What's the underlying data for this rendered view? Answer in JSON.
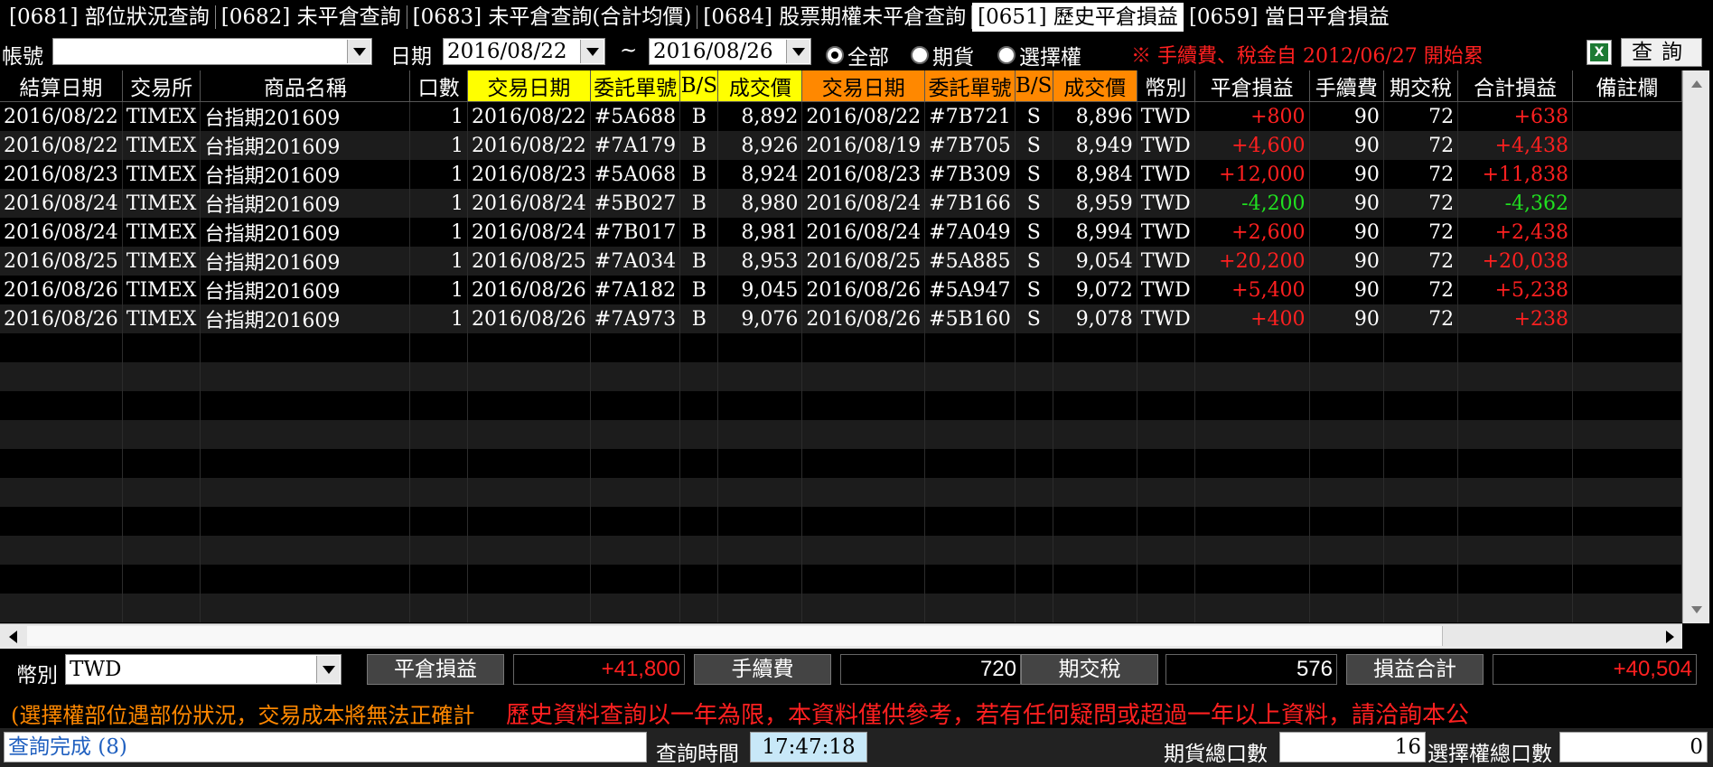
{
  "tabs": [
    {
      "label": "[0681] 部位狀況查詢",
      "active": false
    },
    {
      "label": "[0682] 未平倉查詢",
      "active": false
    },
    {
      "label": "[0683] 未平倉查詢(合計均價)",
      "active": false
    },
    {
      "label": "[0684] 股票期權未平倉查詢",
      "active": false
    },
    {
      "label": "[0651] 歷史平倉損益",
      "active": true
    },
    {
      "label": "[0659] 當日平倉損益",
      "active": false
    }
  ],
  "toolbar": {
    "account_label": "帳號",
    "account_value": "",
    "date_label": "日期",
    "date_from": "2016/08/22",
    "date_sep": "~",
    "date_to": "2016/08/26",
    "radio_all": "全部",
    "radio_futures": "期貨",
    "radio_options": "選擇權",
    "notice": "※ 手續費、稅金自 2012/06/27 開始累",
    "excel_icon_letter": "X",
    "query_label": "查詢"
  },
  "columns": [
    "結算日期",
    "交易所",
    "商品名稱",
    "口數",
    "交易日期",
    "委託單號",
    "B/S",
    "成交價",
    "交易日期",
    "委託單號",
    "B/S",
    "成交價",
    "幣別",
    "平倉損益",
    "手續費",
    "期交稅",
    "合計損益",
    "備註欄"
  ],
  "rows": [
    [
      "2016/08/22",
      "TIMEX",
      "台指期201609",
      "1",
      "2016/08/22",
      "#5A688",
      "B",
      "8,892",
      "2016/08/22",
      "#7B721",
      "S",
      "8,896",
      "TWD",
      "+800",
      "90",
      "72",
      "+638",
      ""
    ],
    [
      "2016/08/22",
      "TIMEX",
      "台指期201609",
      "1",
      "2016/08/22",
      "#7A179",
      "B",
      "8,926",
      "2016/08/19",
      "#7B705",
      "S",
      "8,949",
      "TWD",
      "+4,600",
      "90",
      "72",
      "+4,438",
      ""
    ],
    [
      "2016/08/23",
      "TIMEX",
      "台指期201609",
      "1",
      "2016/08/23",
      "#5A068",
      "B",
      "8,924",
      "2016/08/23",
      "#7B309",
      "S",
      "8,984",
      "TWD",
      "+12,000",
      "90",
      "72",
      "+11,838",
      ""
    ],
    [
      "2016/08/24",
      "TIMEX",
      "台指期201609",
      "1",
      "2016/08/24",
      "#5B027",
      "B",
      "8,980",
      "2016/08/24",
      "#7B166",
      "S",
      "8,959",
      "TWD",
      "-4,200",
      "90",
      "72",
      "-4,362",
      ""
    ],
    [
      "2016/08/24",
      "TIMEX",
      "台指期201609",
      "1",
      "2016/08/24",
      "#7B017",
      "B",
      "8,981",
      "2016/08/24",
      "#7A049",
      "S",
      "8,994",
      "TWD",
      "+2,600",
      "90",
      "72",
      "+2,438",
      ""
    ],
    [
      "2016/08/25",
      "TIMEX",
      "台指期201609",
      "1",
      "2016/08/25",
      "#7A034",
      "B",
      "8,953",
      "2016/08/25",
      "#5A885",
      "S",
      "9,054",
      "TWD",
      "+20,200",
      "90",
      "72",
      "+20,038",
      ""
    ],
    [
      "2016/08/26",
      "TIMEX",
      "台指期201609",
      "1",
      "2016/08/26",
      "#7A182",
      "B",
      "9,045",
      "2016/08/26",
      "#5A947",
      "S",
      "9,072",
      "TWD",
      "+5,400",
      "90",
      "72",
      "+5,238",
      ""
    ],
    [
      "2016/08/26",
      "TIMEX",
      "台指期201609",
      "1",
      "2016/08/26",
      "#7A973",
      "B",
      "9,076",
      "2016/08/26",
      "#5B160",
      "S",
      "9,078",
      "TWD",
      "+400",
      "90",
      "72",
      "+238",
      ""
    ]
  ],
  "summary": {
    "currency_label": "幣別",
    "currency_value": "TWD",
    "pnl_label": "平倉損益",
    "pnl_value": "+41,800",
    "fee_label": "手續費",
    "fee_value": "720",
    "tax_label": "期交稅",
    "tax_value": "576",
    "total_label": "損益合計",
    "total_value": "+40,504"
  },
  "marquee": {
    "left_text": "(選擇權部位遇部份狀況，交易成本將無法正確計",
    "right_text": "歷史資料查詢以一年為限，本資料僅供參考，若有任何疑問或超過一年以上資料，請洽詢本公"
  },
  "status": {
    "message": "查詢完成 (8)",
    "time_label": "查詢時間",
    "time_value": "17:47:18",
    "futures_count_label": "期貨總口數",
    "futures_count_value": "16",
    "options_count_label": "選擇權總口數",
    "options_count_value": "0"
  },
  "colors": {
    "profit": "#ff2020",
    "loss": "#20e020",
    "open_header": "#ffff00",
    "close_header": "#ff8800"
  }
}
